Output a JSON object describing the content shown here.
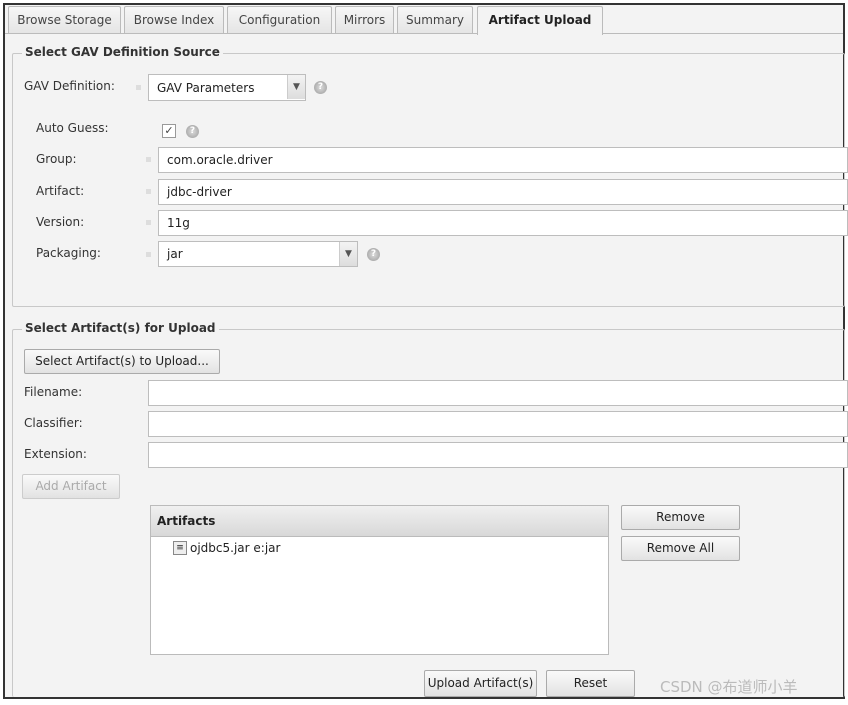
{
  "tabs": [
    "Browse Storage",
    "Browse Index",
    "Configuration",
    "Mirrors",
    "Summary",
    "Artifact Upload"
  ],
  "active_tab": "Artifact Upload",
  "gav_section": {
    "legend": "Select GAV Definition Source",
    "gav_definition_label": "GAV Definition:",
    "gav_definition_value": "GAV Parameters",
    "auto_guess_label": "Auto Guess:",
    "auto_guess_checked": true,
    "group_label": "Group:",
    "group_value": "com.oracle.driver",
    "artifact_label": "Artifact:",
    "artifact_value": "jdbc-driver",
    "version_label": "Version:",
    "version_value": "11g",
    "packaging_label": "Packaging:",
    "packaging_value": "jar"
  },
  "upload_section": {
    "legend": "Select Artifact(s) for Upload",
    "select_button": "Select Artifact(s) to Upload...",
    "filename_label": "Filename:",
    "filename_value": "",
    "classifier_label": "Classifier:",
    "classifier_value": "",
    "extension_label": "Extension:",
    "extension_value": "",
    "add_button": "Add Artifact",
    "grid_header": "Artifacts",
    "artifacts": [
      "ojdbc5.jar e:jar"
    ],
    "remove_button": "Remove",
    "remove_all_button": "Remove All",
    "upload_button": "Upload Artifact(s)",
    "reset_button": "Reset"
  },
  "watermark": "CSDN @布道师小羊"
}
